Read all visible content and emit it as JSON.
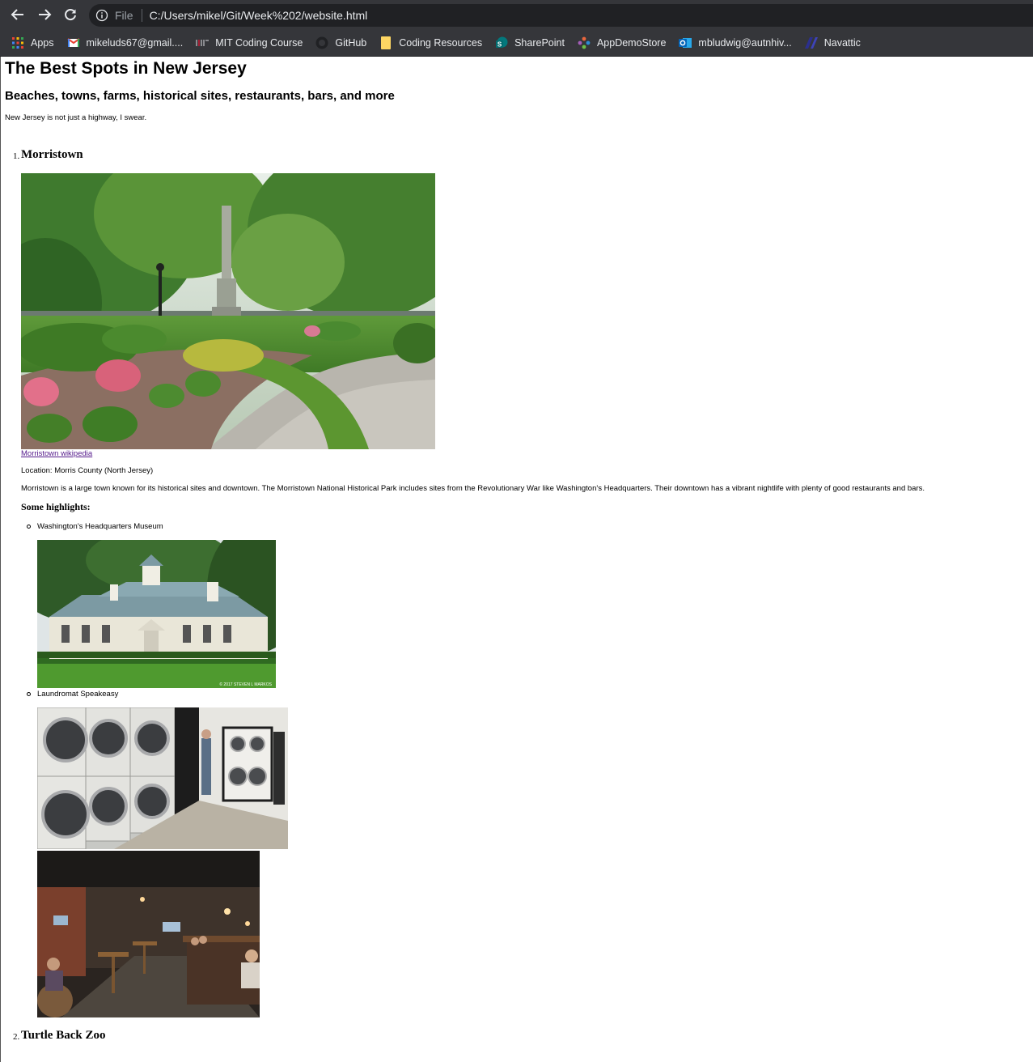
{
  "browser": {
    "url_scheme": "File",
    "url": "C:/Users/mikel/Git/Week%202/website.html",
    "bookmarks": [
      {
        "label": "Apps",
        "icon": "apps-grid-icon"
      },
      {
        "label": "mikeluds67@gmail....",
        "icon": "gmail-icon"
      },
      {
        "label": "MIT Coding Course",
        "icon": "mit-icon"
      },
      {
        "label": "GitHub",
        "icon": "github-icon"
      },
      {
        "label": "Coding Resources",
        "icon": "folder-icon"
      },
      {
        "label": "SharePoint",
        "icon": "sharepoint-icon"
      },
      {
        "label": "AppDemoStore",
        "icon": "appdemostore-icon"
      },
      {
        "label": "mbludwig@autnhiv...",
        "icon": "outlook-icon"
      },
      {
        "label": "Navattic",
        "icon": "navattic-icon"
      }
    ]
  },
  "page": {
    "title": "The Best Spots in New Jersey",
    "subtitle": "Beaches, towns, farms, historical sites, restaurants, bars, and more",
    "intro": "New Jersey is not just a highway, I swear.",
    "items": [
      {
        "number": "1.",
        "name": "Morristown",
        "link_text": "Morristown wikipedia",
        "location": "Location: Morris County (North Jersey)",
        "description": "Morristown is a large town known for its historical sites and downtown. The Morristown National Historical Park includes sites from the Revolutionary War like Washington's Headquarters. Their downtown has a vibrant nightlife with plenty of good restaurants and bars.",
        "highlights_heading": "Some highlights:",
        "highlights": [
          {
            "label": "Washington's Headquarters Museum",
            "photo_credit": "© 2017 STEVEN L MARKOS"
          },
          {
            "label": "Laundromat Speakeasy"
          }
        ]
      },
      {
        "number": "2.",
        "name": "Turtle Back Zoo"
      }
    ]
  }
}
